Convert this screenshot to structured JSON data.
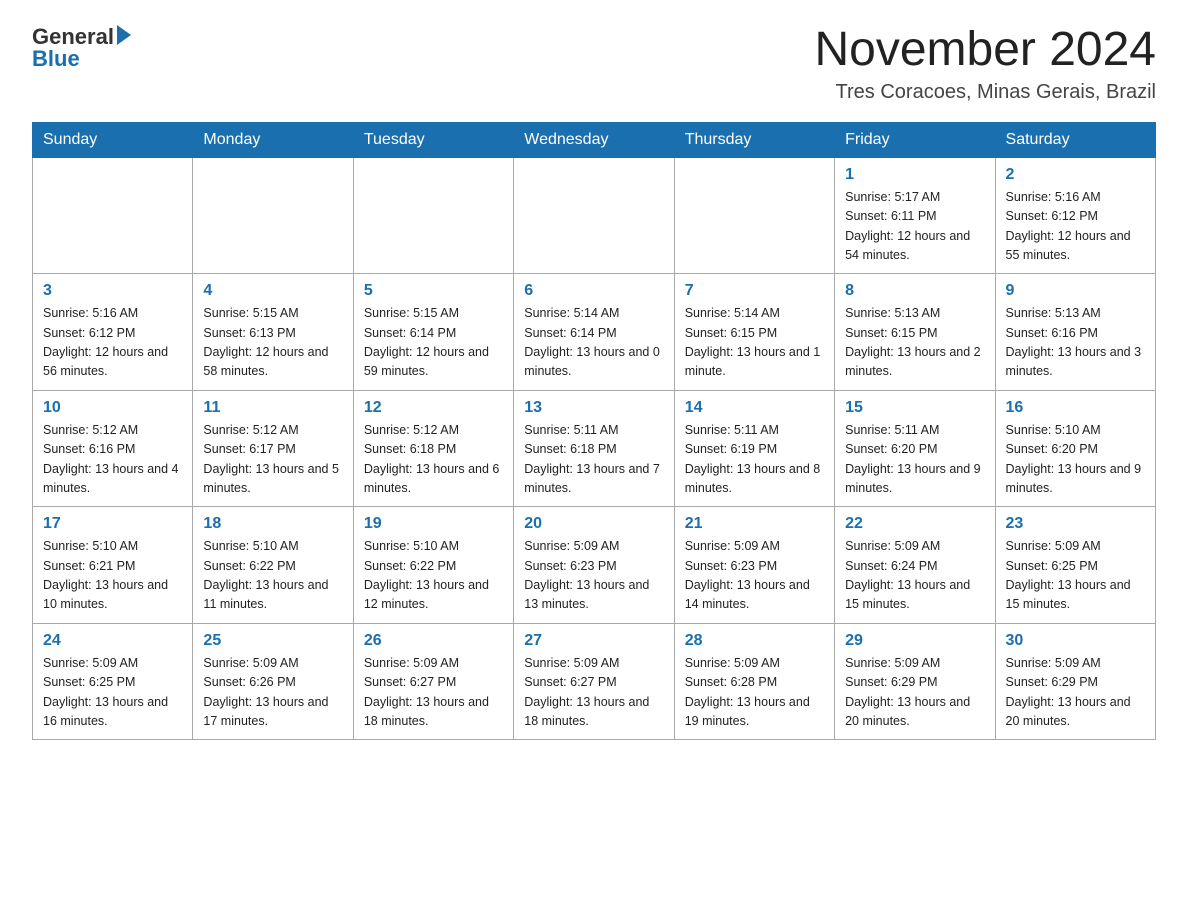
{
  "header": {
    "logo_general": "General",
    "logo_blue": "Blue",
    "month_title": "November 2024",
    "location": "Tres Coracoes, Minas Gerais, Brazil"
  },
  "days_of_week": [
    "Sunday",
    "Monday",
    "Tuesday",
    "Wednesday",
    "Thursday",
    "Friday",
    "Saturday"
  ],
  "weeks": [
    [
      {
        "day": "",
        "info": ""
      },
      {
        "day": "",
        "info": ""
      },
      {
        "day": "",
        "info": ""
      },
      {
        "day": "",
        "info": ""
      },
      {
        "day": "",
        "info": ""
      },
      {
        "day": "1",
        "info": "Sunrise: 5:17 AM\nSunset: 6:11 PM\nDaylight: 12 hours\nand 54 minutes."
      },
      {
        "day": "2",
        "info": "Sunrise: 5:16 AM\nSunset: 6:12 PM\nDaylight: 12 hours\nand 55 minutes."
      }
    ],
    [
      {
        "day": "3",
        "info": "Sunrise: 5:16 AM\nSunset: 6:12 PM\nDaylight: 12 hours\nand 56 minutes."
      },
      {
        "day": "4",
        "info": "Sunrise: 5:15 AM\nSunset: 6:13 PM\nDaylight: 12 hours\nand 58 minutes."
      },
      {
        "day": "5",
        "info": "Sunrise: 5:15 AM\nSunset: 6:14 PM\nDaylight: 12 hours\nand 59 minutes."
      },
      {
        "day": "6",
        "info": "Sunrise: 5:14 AM\nSunset: 6:14 PM\nDaylight: 13 hours\nand 0 minutes."
      },
      {
        "day": "7",
        "info": "Sunrise: 5:14 AM\nSunset: 6:15 PM\nDaylight: 13 hours\nand 1 minute."
      },
      {
        "day": "8",
        "info": "Sunrise: 5:13 AM\nSunset: 6:15 PM\nDaylight: 13 hours\nand 2 minutes."
      },
      {
        "day": "9",
        "info": "Sunrise: 5:13 AM\nSunset: 6:16 PM\nDaylight: 13 hours\nand 3 minutes."
      }
    ],
    [
      {
        "day": "10",
        "info": "Sunrise: 5:12 AM\nSunset: 6:16 PM\nDaylight: 13 hours\nand 4 minutes."
      },
      {
        "day": "11",
        "info": "Sunrise: 5:12 AM\nSunset: 6:17 PM\nDaylight: 13 hours\nand 5 minutes."
      },
      {
        "day": "12",
        "info": "Sunrise: 5:12 AM\nSunset: 6:18 PM\nDaylight: 13 hours\nand 6 minutes."
      },
      {
        "day": "13",
        "info": "Sunrise: 5:11 AM\nSunset: 6:18 PM\nDaylight: 13 hours\nand 7 minutes."
      },
      {
        "day": "14",
        "info": "Sunrise: 5:11 AM\nSunset: 6:19 PM\nDaylight: 13 hours\nand 8 minutes."
      },
      {
        "day": "15",
        "info": "Sunrise: 5:11 AM\nSunset: 6:20 PM\nDaylight: 13 hours\nand 9 minutes."
      },
      {
        "day": "16",
        "info": "Sunrise: 5:10 AM\nSunset: 6:20 PM\nDaylight: 13 hours\nand 9 minutes."
      }
    ],
    [
      {
        "day": "17",
        "info": "Sunrise: 5:10 AM\nSunset: 6:21 PM\nDaylight: 13 hours\nand 10 minutes."
      },
      {
        "day": "18",
        "info": "Sunrise: 5:10 AM\nSunset: 6:22 PM\nDaylight: 13 hours\nand 11 minutes."
      },
      {
        "day": "19",
        "info": "Sunrise: 5:10 AM\nSunset: 6:22 PM\nDaylight: 13 hours\nand 12 minutes."
      },
      {
        "day": "20",
        "info": "Sunrise: 5:09 AM\nSunset: 6:23 PM\nDaylight: 13 hours\nand 13 minutes."
      },
      {
        "day": "21",
        "info": "Sunrise: 5:09 AM\nSunset: 6:23 PM\nDaylight: 13 hours\nand 14 minutes."
      },
      {
        "day": "22",
        "info": "Sunrise: 5:09 AM\nSunset: 6:24 PM\nDaylight: 13 hours\nand 15 minutes."
      },
      {
        "day": "23",
        "info": "Sunrise: 5:09 AM\nSunset: 6:25 PM\nDaylight: 13 hours\nand 15 minutes."
      }
    ],
    [
      {
        "day": "24",
        "info": "Sunrise: 5:09 AM\nSunset: 6:25 PM\nDaylight: 13 hours\nand 16 minutes."
      },
      {
        "day": "25",
        "info": "Sunrise: 5:09 AM\nSunset: 6:26 PM\nDaylight: 13 hours\nand 17 minutes."
      },
      {
        "day": "26",
        "info": "Sunrise: 5:09 AM\nSunset: 6:27 PM\nDaylight: 13 hours\nand 18 minutes."
      },
      {
        "day": "27",
        "info": "Sunrise: 5:09 AM\nSunset: 6:27 PM\nDaylight: 13 hours\nand 18 minutes."
      },
      {
        "day": "28",
        "info": "Sunrise: 5:09 AM\nSunset: 6:28 PM\nDaylight: 13 hours\nand 19 minutes."
      },
      {
        "day": "29",
        "info": "Sunrise: 5:09 AM\nSunset: 6:29 PM\nDaylight: 13 hours\nand 20 minutes."
      },
      {
        "day": "30",
        "info": "Sunrise: 5:09 AM\nSunset: 6:29 PM\nDaylight: 13 hours\nand 20 minutes."
      }
    ]
  ]
}
